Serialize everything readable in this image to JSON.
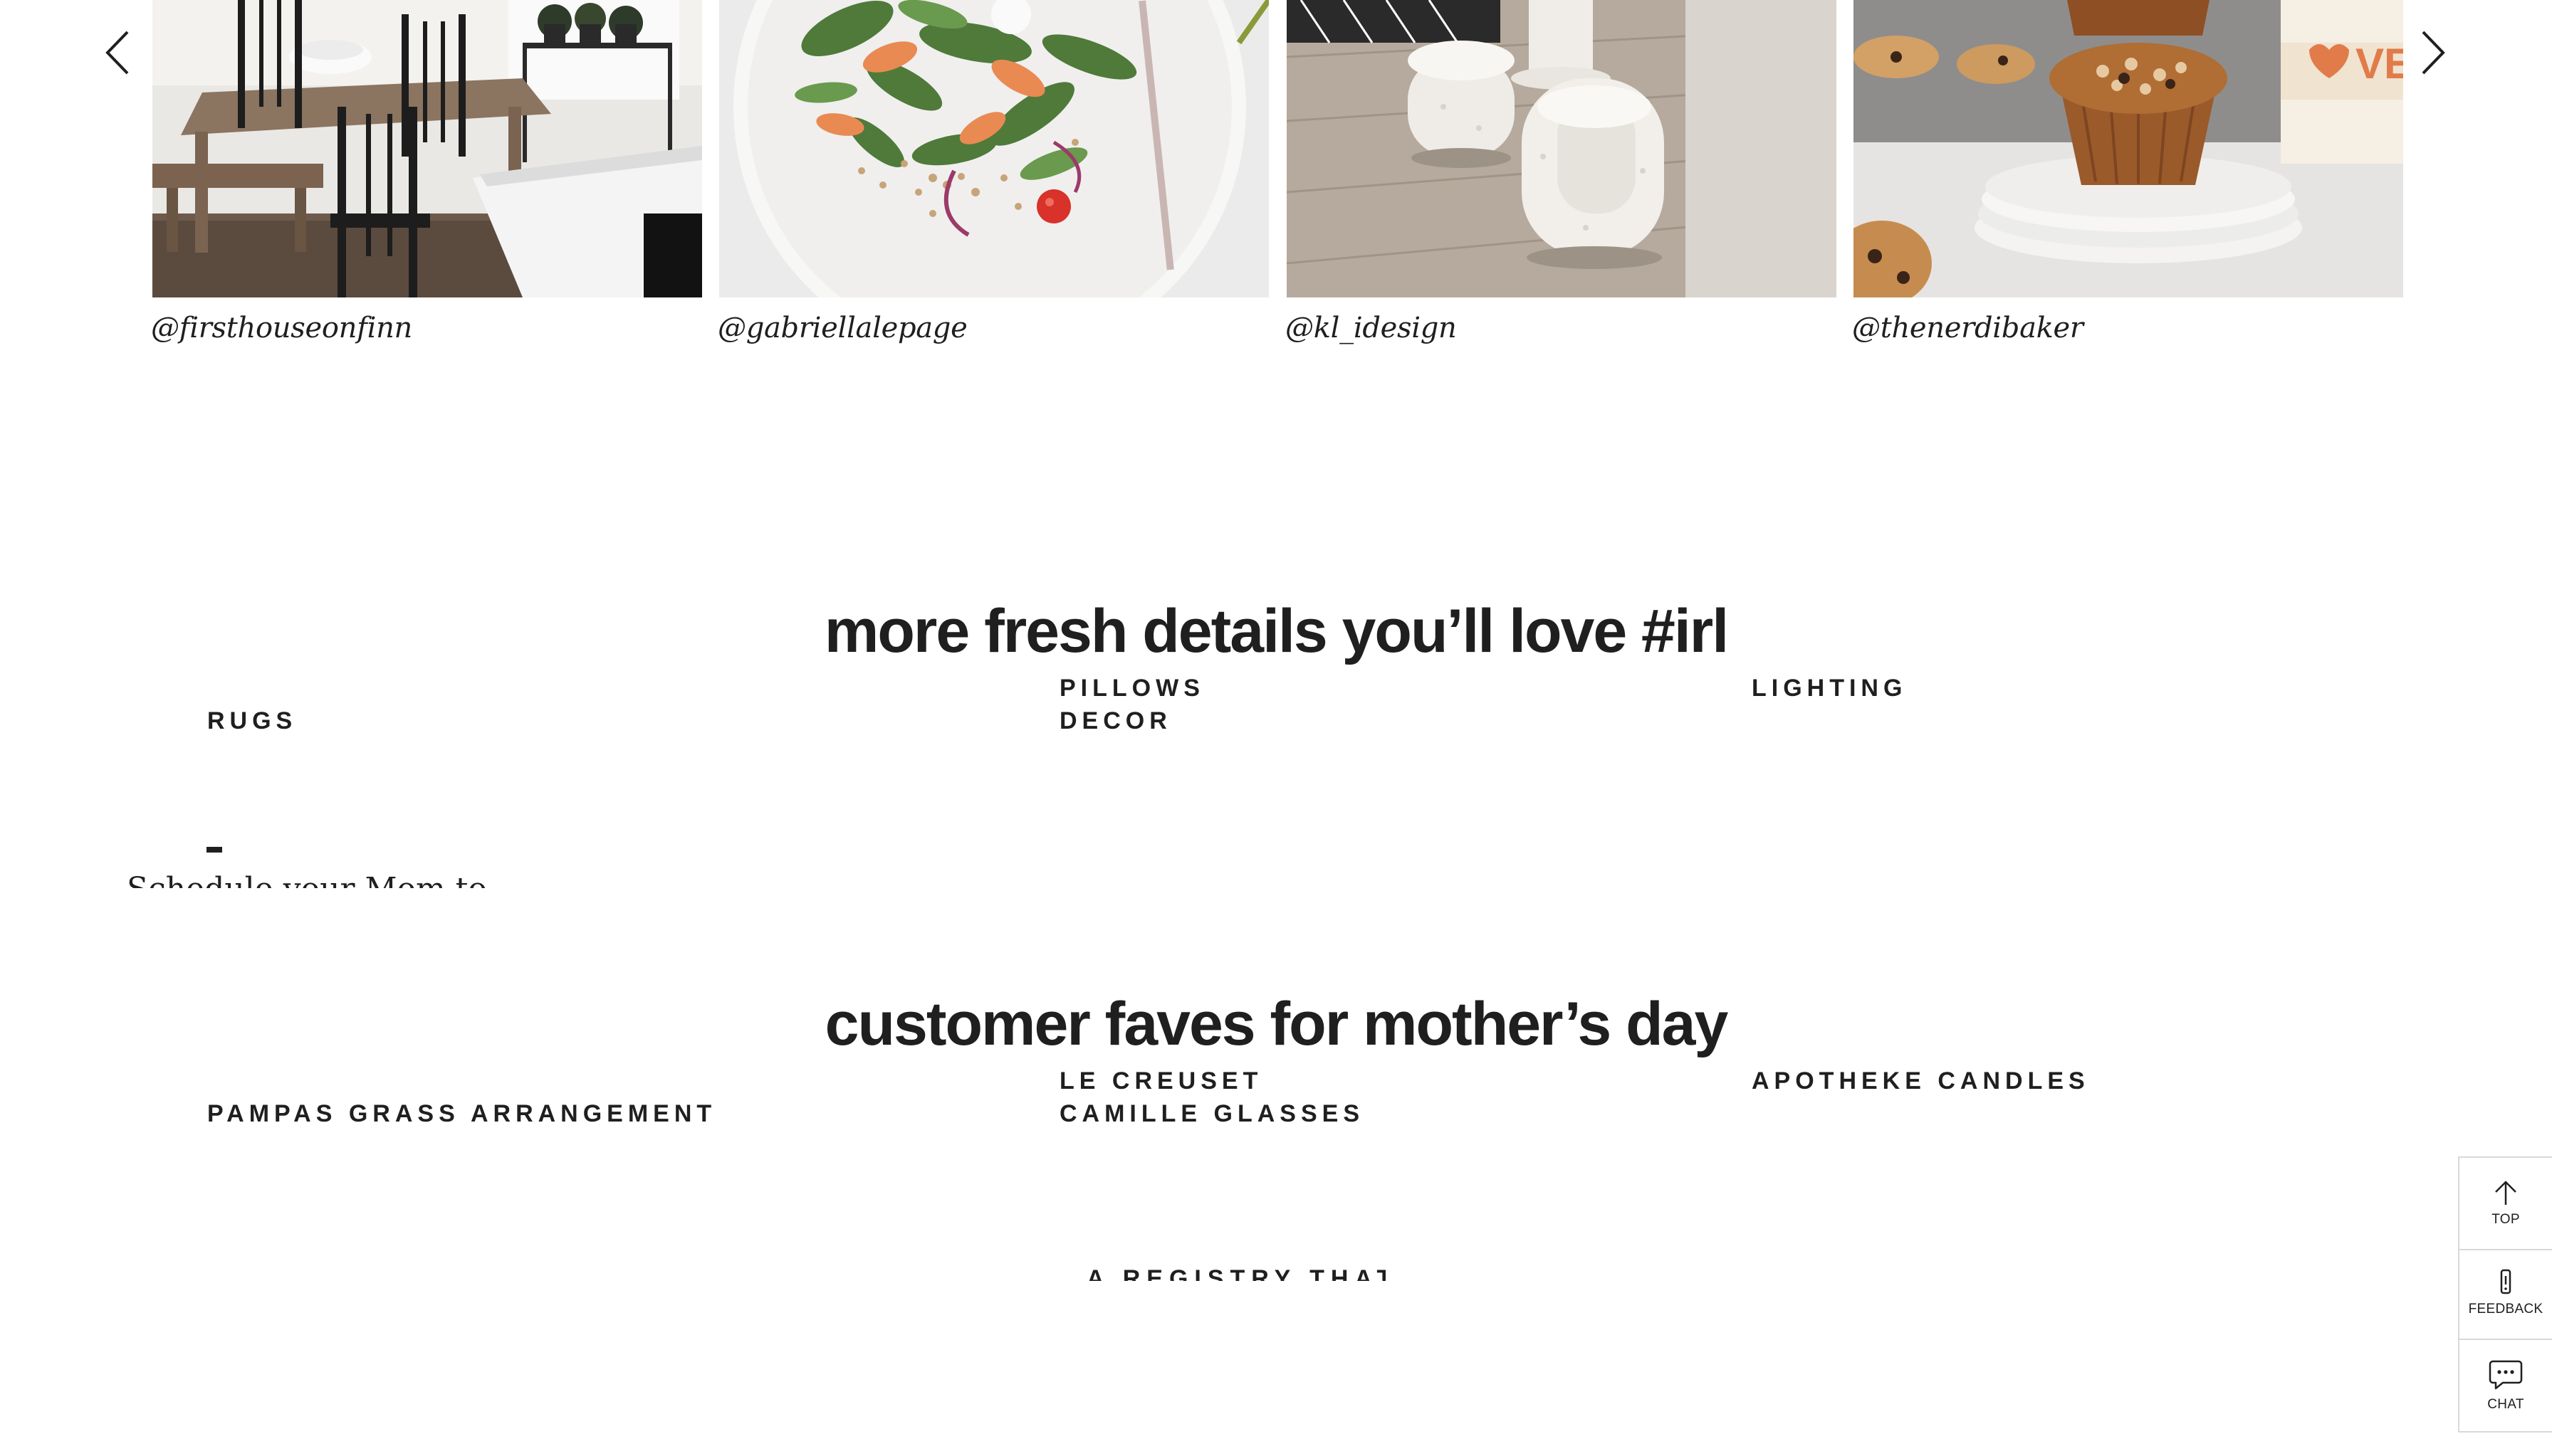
{
  "carousel": {
    "prev_icon": "chevron-left-icon",
    "next_icon": "chevron-right-icon",
    "tiles": [
      {
        "handle": "@firsthouseonfinn",
        "image": "dining-table-photo"
      },
      {
        "handle": "@gabriellalepage",
        "image": "salad-plate-photo"
      },
      {
        "handle": "@kl_idesign",
        "image": "boucle-stools-photo"
      },
      {
        "handle": "@thenerdibaker",
        "image": "muffins-photo"
      }
    ]
  },
  "section_irl": {
    "title": "more fresh details you’ll love #irl",
    "categories": [
      "RUGS",
      "PILLOWS",
      "DECOR",
      "LIGHTING"
    ]
  },
  "section_mothers_day": {
    "title": "customer faves for mother’s day",
    "products": [
      "PAMPAS GRASS ARRANGEMENT",
      "LE CREUSET",
      "CAMILLE GLASSES",
      "APOTHEKE CANDLES"
    ]
  },
  "fragments": {
    "partial_text": "Schedule your Mom to",
    "registry_teaser": "A REGISTRY THAT'S"
  },
  "side_widget": {
    "top_label": "TOP",
    "feedback_label": "FEEDBACK",
    "chat_label": "CHAT"
  },
  "colors": {
    "text": "#1f1f1f",
    "border": "#d9d9d9",
    "background": "#ffffff"
  }
}
